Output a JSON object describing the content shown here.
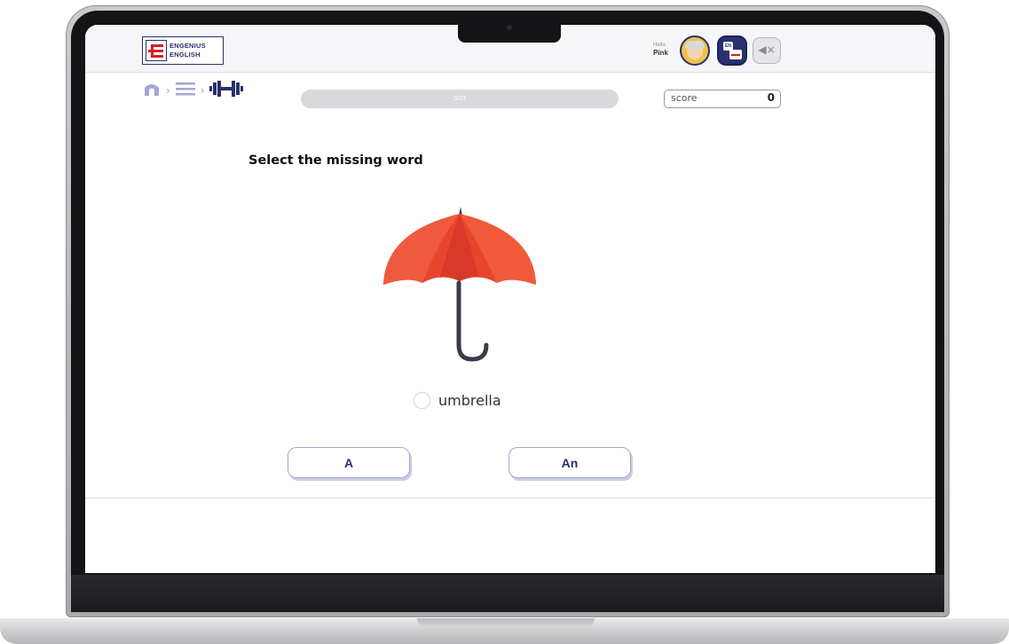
{
  "header": {
    "logo": {
      "line1": "ENGENIUS",
      "line2": "ENGLISH",
      "brand_red": "#d42029",
      "brand_navy": "#2a2f6e"
    },
    "greeting": {
      "hello": "Hello",
      "name": "Pink"
    },
    "icons": [
      "avatar",
      "language-icon",
      "sound-muted-icon"
    ],
    "language_badge": "EN"
  },
  "nav": {
    "icons": [
      "home-icon",
      "menu-icon",
      "dumbbell-icon"
    ],
    "separator": "›"
  },
  "progress": {
    "text": "0/23",
    "current": 0,
    "total": 23
  },
  "score": {
    "label": "score",
    "value": "0"
  },
  "question": {
    "instruction": "Select the missing word",
    "image": "umbrella-illustration",
    "word": "umbrella"
  },
  "answers": [
    {
      "label": "A"
    },
    {
      "label": "An"
    }
  ],
  "colors": {
    "umbrella_red": "#e8452c",
    "umbrella_dark": "#d0361f",
    "handle": "#3a3a48",
    "accent": "#2a2f6e"
  }
}
